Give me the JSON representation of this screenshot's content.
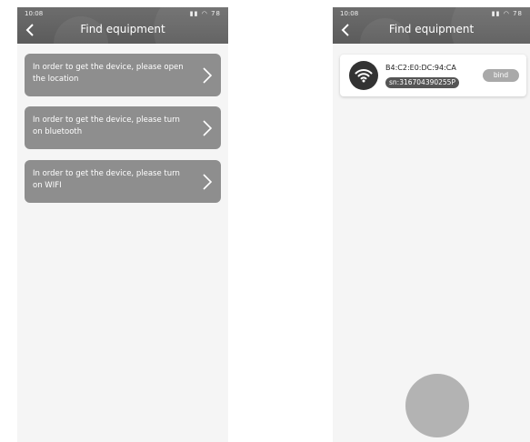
{
  "status_bar": {
    "time": "10:08",
    "battery": "78"
  },
  "colors": {
    "header_bg": "#5e5e5e",
    "prompt_card_bg": "#8e8e8e",
    "bind_button_bg": "#a9a9a9",
    "scan_button_bg": "#b3b3b3"
  },
  "left_screen": {
    "title": "Find equipment",
    "prompts": [
      {
        "text": "In order to get the device, please open the location",
        "icon": "chevron-right-icon"
      },
      {
        "text": "In order to get the device, please turn on bluetooth",
        "icon": "chevron-right-icon"
      },
      {
        "text": "In order to get the device, please turn on WIFI",
        "icon": "chevron-right-icon"
      }
    ]
  },
  "right_screen": {
    "title": "Find equipment",
    "device": {
      "icon": "wifi-icon",
      "mac": "B4:C2:E0:DC:94:CA",
      "sn": "sn:316704390255P",
      "bind_label": "bind"
    }
  }
}
